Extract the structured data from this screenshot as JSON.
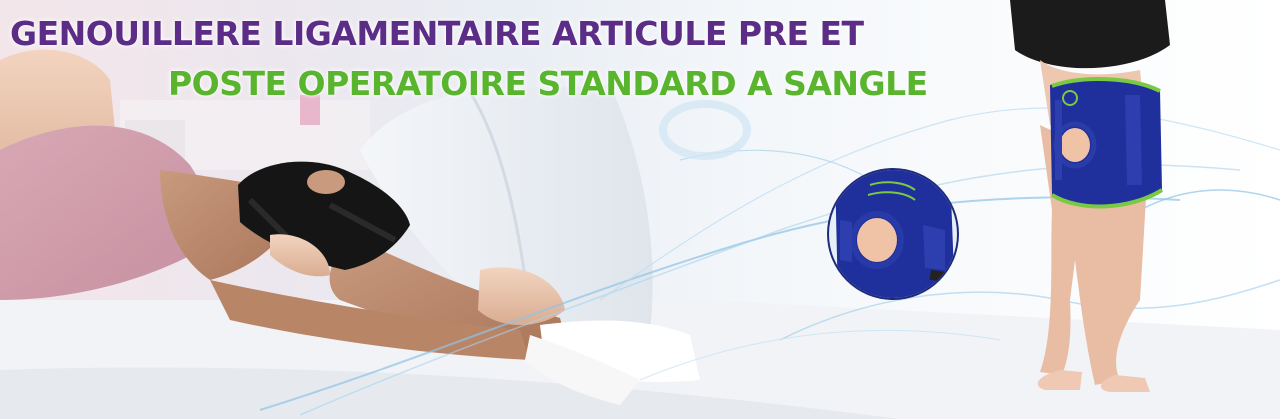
{
  "banner": {
    "title_line_1": "GENOUILLERE LIGAMENTAIRE ARTICULE PRE ET",
    "title_line_2": "POSTE OPERATOIRE STANDARD A SANGLE"
  },
  "colors": {
    "title_purple": "#5b2d86",
    "title_green": "#5ab52e",
    "brace_navy": "#1f2f9c",
    "brace_trim_green": "#7ac943",
    "brace_black": "#151515",
    "swirl_blue": "#8fc3e6"
  }
}
